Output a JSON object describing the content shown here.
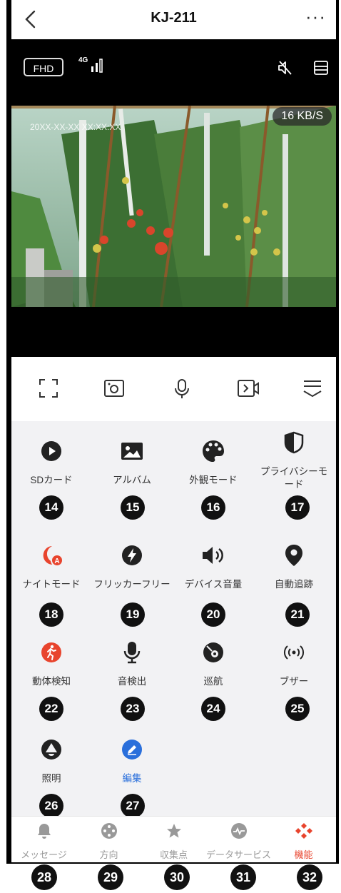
{
  "header": {
    "title": "KJ-211",
    "more": "···"
  },
  "video": {
    "quality": "FHD",
    "network": "4G",
    "speed": "16 KB/S",
    "timestamp": "20XX-XX-XX XX:XX:XX"
  },
  "toolbar": [
    "fullscreen-icon",
    "screenshot-icon",
    "microphone-icon",
    "record-icon",
    "collapse-icon"
  ],
  "features": [
    {
      "label": "SDカード",
      "num": "14"
    },
    {
      "label": "アルバム",
      "num": "15"
    },
    {
      "label": "外観モード",
      "num": "16"
    },
    {
      "label": "プライバシーモード",
      "num": "17"
    },
    {
      "label": "ナイトモード",
      "num": "18"
    },
    {
      "label": "フリッカーフリー",
      "num": "19"
    },
    {
      "label": "デバイス音量",
      "num": "20"
    },
    {
      "label": "自動追跡",
      "num": "21"
    },
    {
      "label": "動体検知",
      "num": "22"
    },
    {
      "label": "音検出",
      "num": "23"
    },
    {
      "label": "巡航",
      "num": "24"
    },
    {
      "label": "ブザー",
      "num": "25"
    },
    {
      "label": "照明",
      "num": "26"
    },
    {
      "label": "編集",
      "num": "27"
    }
  ],
  "tabs": [
    {
      "label": "メッセージ",
      "num": "28"
    },
    {
      "label": "方向",
      "num": "29"
    },
    {
      "label": "収集点",
      "num": "30"
    },
    {
      "label": "データサービス",
      "num": "31"
    },
    {
      "label": "機能",
      "num": "32"
    }
  ],
  "colors": {
    "accent": "#e8442d",
    "edit": "#2a6fdb",
    "dark": "#222222"
  }
}
